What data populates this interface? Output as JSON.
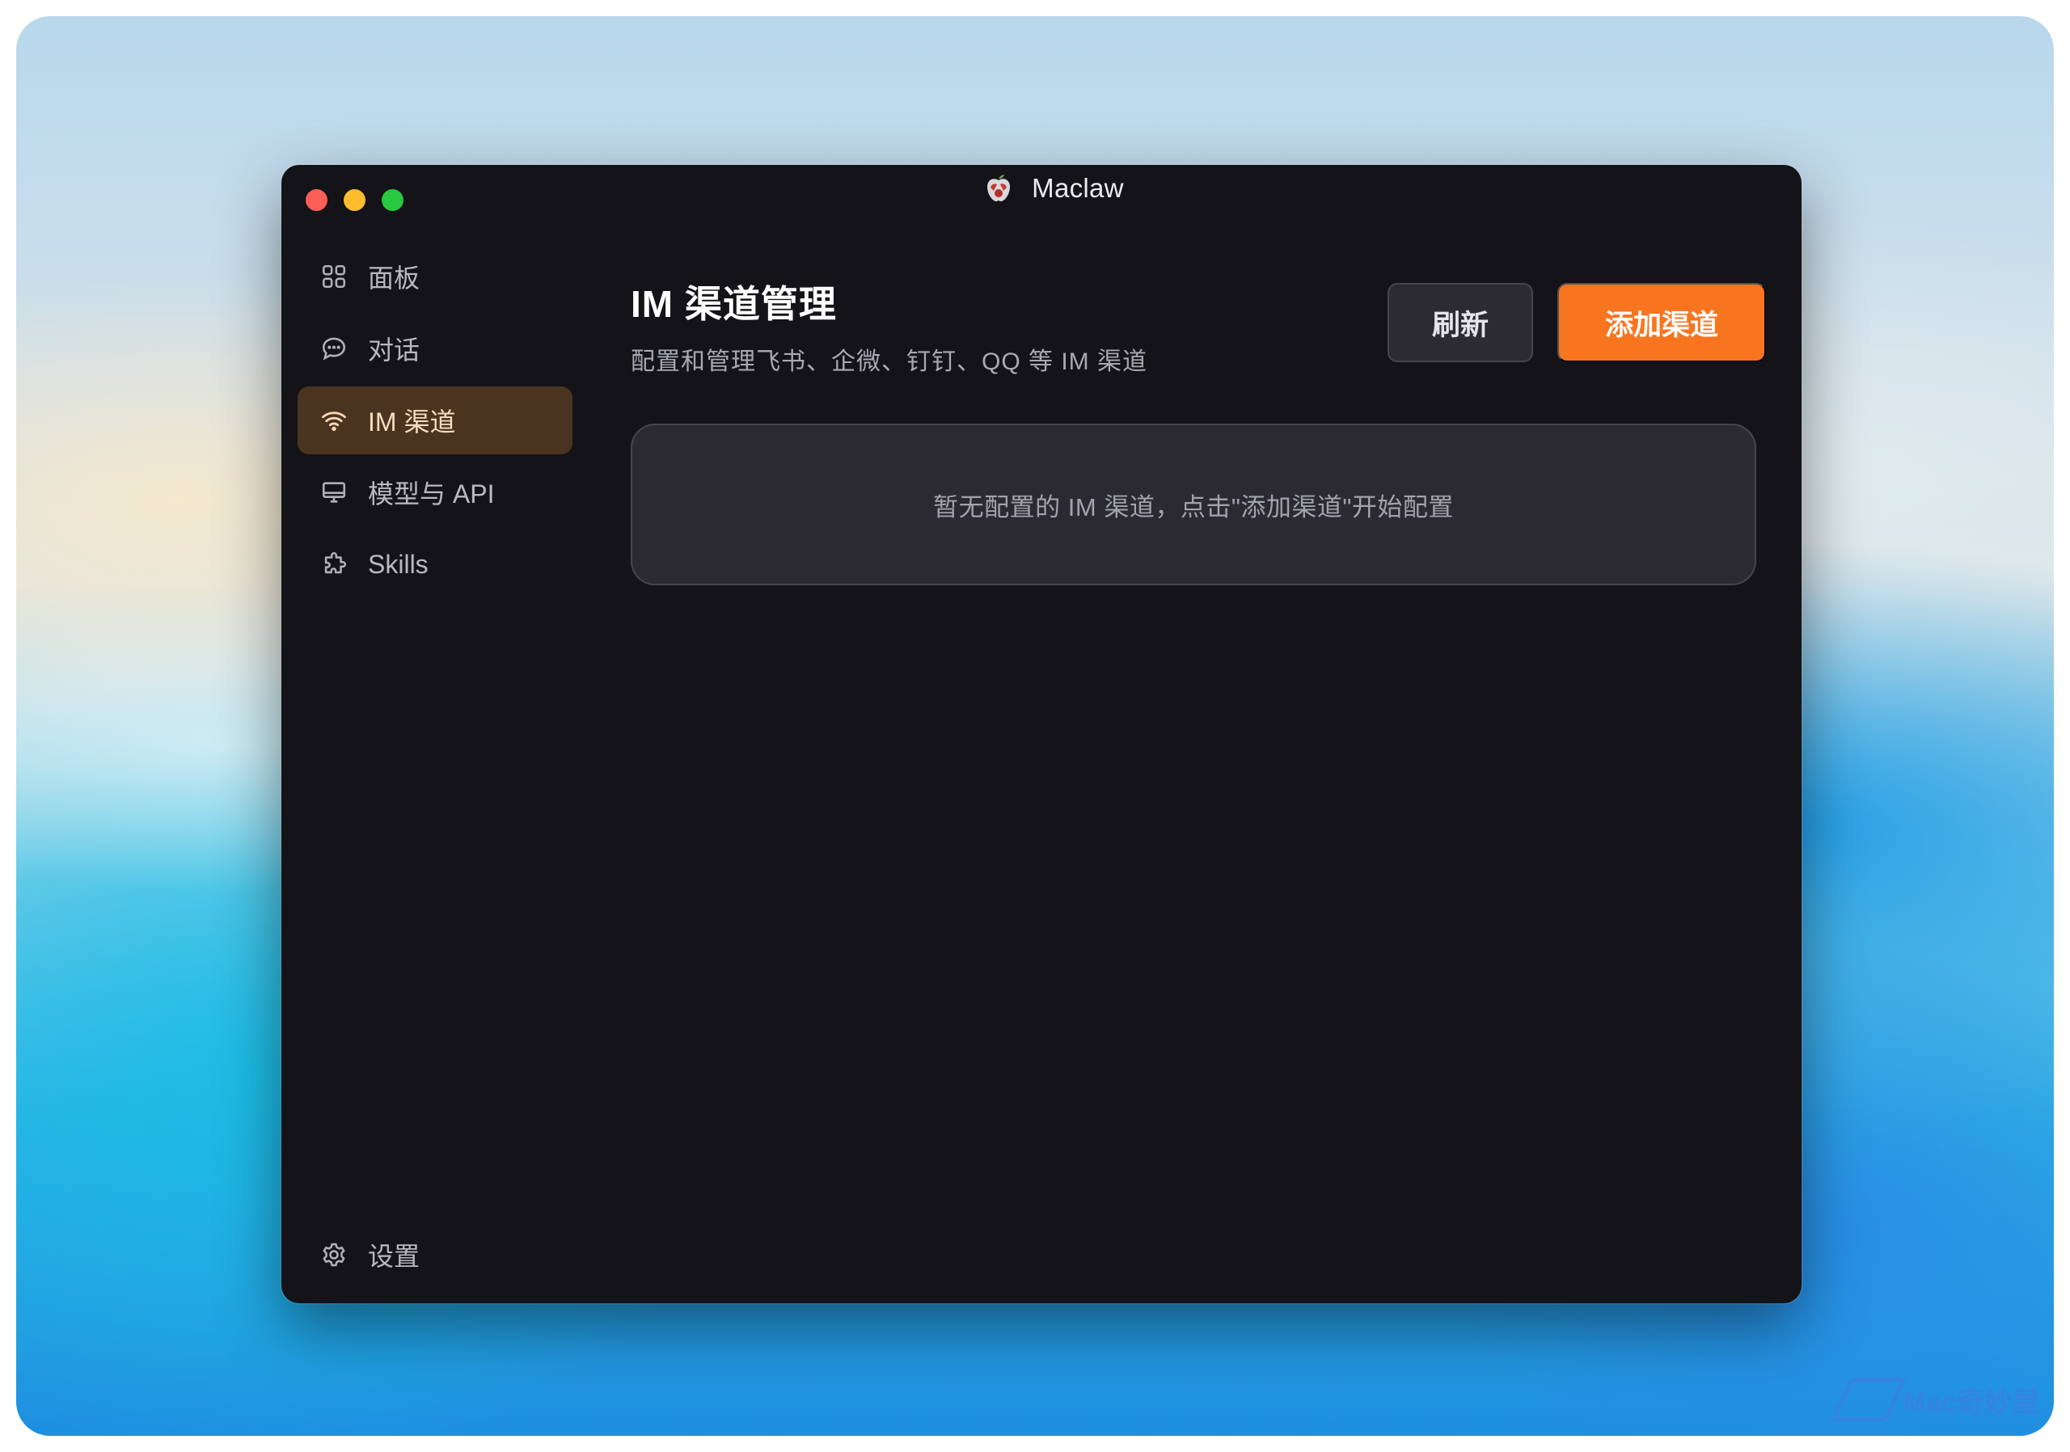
{
  "window": {
    "title": "Maclaw"
  },
  "sidebar": {
    "items": [
      {
        "label": "面板",
        "icon": "grid-icon",
        "active": false
      },
      {
        "label": "对话",
        "icon": "chat-bubble-icon",
        "active": false
      },
      {
        "label": "IM 渠道",
        "icon": "wifi-icon",
        "active": true
      },
      {
        "label": "模型与 API",
        "icon": "monitor-icon",
        "active": false
      },
      {
        "label": "Skills",
        "icon": "puzzle-icon",
        "active": false
      }
    ],
    "settings": {
      "label": "设置",
      "icon": "gear-icon"
    }
  },
  "main": {
    "title": "IM 渠道管理",
    "subtitle": "配置和管理飞书、企微、钉钉、QQ 等 IM 渠道",
    "refresh_label": "刷新",
    "add_label": "添加渠道",
    "empty_message": "暂无配置的 IM 渠道，点击\"添加渠道\"开始配置"
  },
  "desktop": {
    "watermark": "Mac奇妙屋"
  },
  "colors": {
    "accent": "#f87520",
    "active_nav_bg": "#4a3420",
    "window_bg": "#131318",
    "card_bg": "#2a2a30"
  }
}
